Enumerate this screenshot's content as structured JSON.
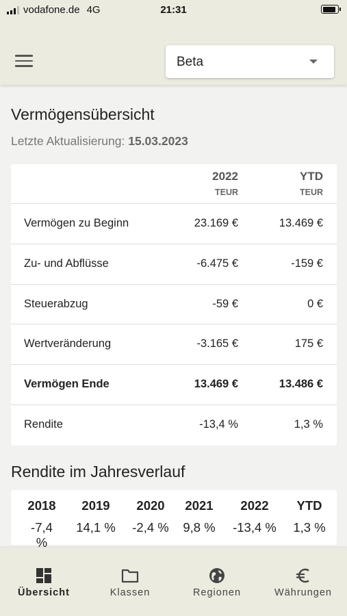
{
  "status_bar": {
    "carrier": "vodafone.de",
    "network": "4G",
    "time": "21:31"
  },
  "header": {
    "portfolio_select": {
      "value": "Beta"
    }
  },
  "overview": {
    "title": "Vermögensübersicht",
    "update_label": "Letzte Aktualisierung:",
    "update_date": "15.03.2023",
    "columns": [
      {
        "year": "2022",
        "unit": "TEUR"
      },
      {
        "year": "YTD",
        "unit": "TEUR"
      }
    ],
    "rows": [
      {
        "label": "Vermögen zu Beginn",
        "v2022": "23.169 €",
        "ytd": "13.469 €",
        "bold": false
      },
      {
        "label": "Zu- und Abflüsse",
        "v2022": "-6.475 €",
        "ytd": "-159 €",
        "bold": false
      },
      {
        "label": "Steuerabzug",
        "v2022": "-59 €",
        "ytd": "0 €",
        "bold": false
      },
      {
        "label": "Wertveränderung",
        "v2022": "-3.165 €",
        "ytd": "175 €",
        "bold": false
      },
      {
        "label": "Vermögen Ende",
        "v2022": "13.469 €",
        "ytd": "13.486 €",
        "bold": true
      },
      {
        "label": "Rendite",
        "v2022": "-13,4 %",
        "ytd": "1,3 %",
        "bold": false
      }
    ]
  },
  "returns": {
    "title": "Rendite im Jahresverlauf",
    "years": [
      {
        "year": "2018",
        "value": "-7,4 %"
      },
      {
        "year": "2019",
        "value": "14,1 %"
      },
      {
        "year": "2020",
        "value": "-2,4 %"
      },
      {
        "year": "2021",
        "value": "9,8 %"
      },
      {
        "year": "2022",
        "value": "-13,4 %"
      },
      {
        "year": "YTD",
        "value": "1,3 %"
      }
    ]
  },
  "bottom_nav": {
    "tabs": [
      {
        "label": "Übersicht",
        "icon": "dashboard-icon",
        "active": true
      },
      {
        "label": "Klassen",
        "icon": "folder-icon",
        "active": false
      },
      {
        "label": "Regionen",
        "icon": "globe-icon",
        "active": false
      },
      {
        "label": "Währungen",
        "icon": "euro-icon",
        "active": false
      }
    ]
  }
}
